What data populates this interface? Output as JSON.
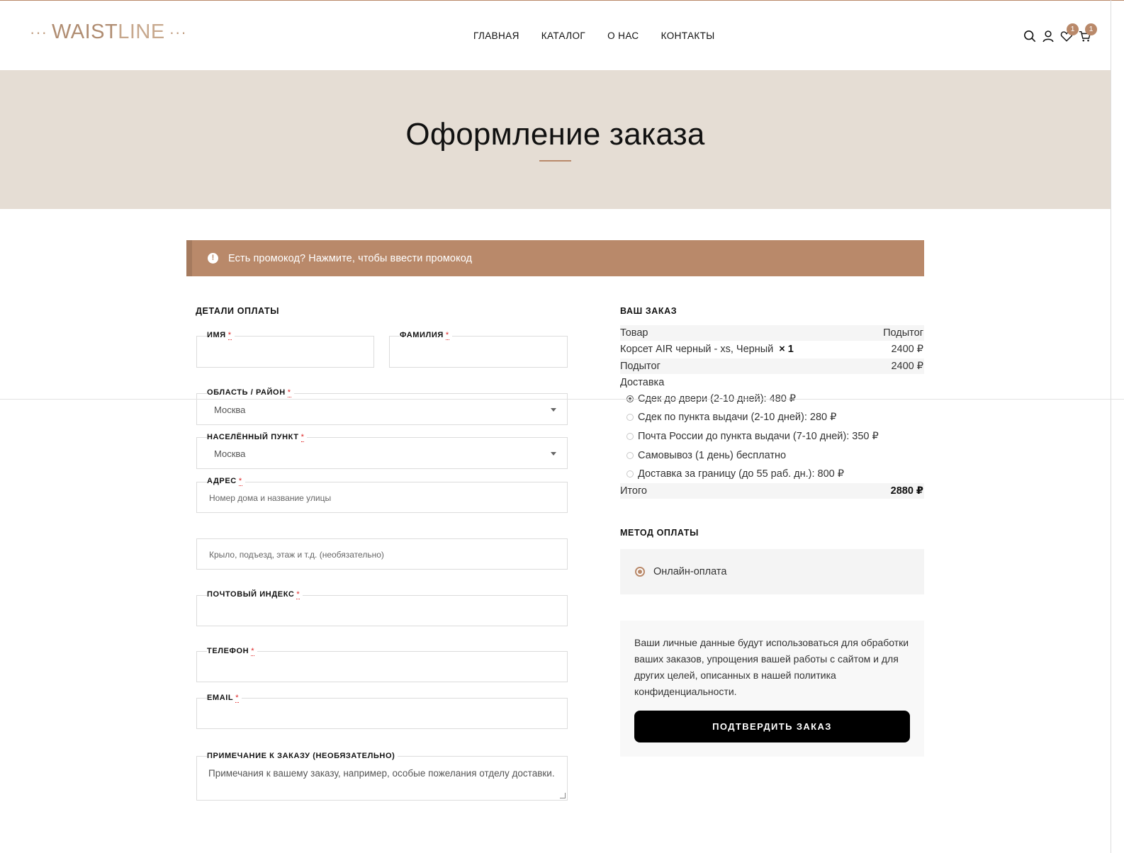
{
  "header": {
    "logo": {
      "dots": "···",
      "part1": "WAIST",
      "part2": "LINE"
    },
    "nav": [
      "ГЛАВНАЯ",
      "КАТАЛОГ",
      "О НАС",
      "КОНТАКТЫ"
    ],
    "wishlist_count": "1",
    "cart_count": "1"
  },
  "hero": {
    "title": "Оформление заказа"
  },
  "notice": {
    "text": "Есть промокод? Нажмите, чтобы ввести промокод"
  },
  "billing": {
    "title": "ДЕТАЛИ ОПЛАТЫ",
    "required_mark": "*",
    "first_name_label": "ИМЯ",
    "last_name_label": "ФАМИЛИЯ",
    "region_label": "ОБЛАСТЬ / РАЙОН",
    "region_value": "Москва",
    "city_label": "НАСЕЛЁННЫЙ ПУНКТ",
    "city_value": "Москва",
    "address_label": "АДРЕС",
    "address_placeholder": "Номер дома и название улицы",
    "address2_placeholder": "Крыло, подъезд, этаж и т.д. (необязательно)",
    "postcode_label": "ПОЧТОВЫЙ ИНДЕКС",
    "phone_label": "ТЕЛЕФОН",
    "email_label": "EMAIL",
    "notes_label": "ПРИМЕЧАНИЕ К ЗАКАЗУ (НЕОБЯЗАТЕЛЬНО)",
    "notes_placeholder": "Примечания к вашему заказу, например, особые пожелания отделу доставки."
  },
  "order": {
    "title": "ВАШ ЗАКАЗ",
    "col_product": "Товар",
    "col_subtotal": "Подытог",
    "item_name": "Корсет AIR черный - xs, Черный",
    "item_qty": "× 1",
    "item_price": "2400 ₽",
    "subtotal_label": "Подытог",
    "subtotal_value": "2400 ₽",
    "shipping_label": "Доставка",
    "shipping_options": [
      {
        "label": "Сдек до двери (2-10 дней): 480 ₽",
        "selected": true
      },
      {
        "label": "Сдек по пункта выдачи (2-10 дней): 280 ₽",
        "selected": false
      },
      {
        "label": "Почта России до пункта выдачи (7-10 дней): 350 ₽",
        "selected": false
      },
      {
        "label": "Самовывоз (1 день) бесплатно",
        "selected": false
      },
      {
        "label": "Доставка за границу (до 55 раб. дн.): 800 ₽",
        "selected": false
      }
    ],
    "total_label": "Итого",
    "total_value": "2880 ₽"
  },
  "payment": {
    "title": "МЕТОД ОПЛАТЫ",
    "method": "Онлайн-оплата",
    "privacy_text": "Ваши личные данные будут использоваться для обработки ваших заказов, упрощения вашей работы с сайтом и для других целей, описанных в нашей политика конфиденциальности.",
    "confirm_label": "ПОДТВЕРДИТЬ ЗАКАЗ"
  },
  "colors": {
    "accent": "#b9896a",
    "hero_bg": "#e5ddd4",
    "button": "#000000"
  }
}
